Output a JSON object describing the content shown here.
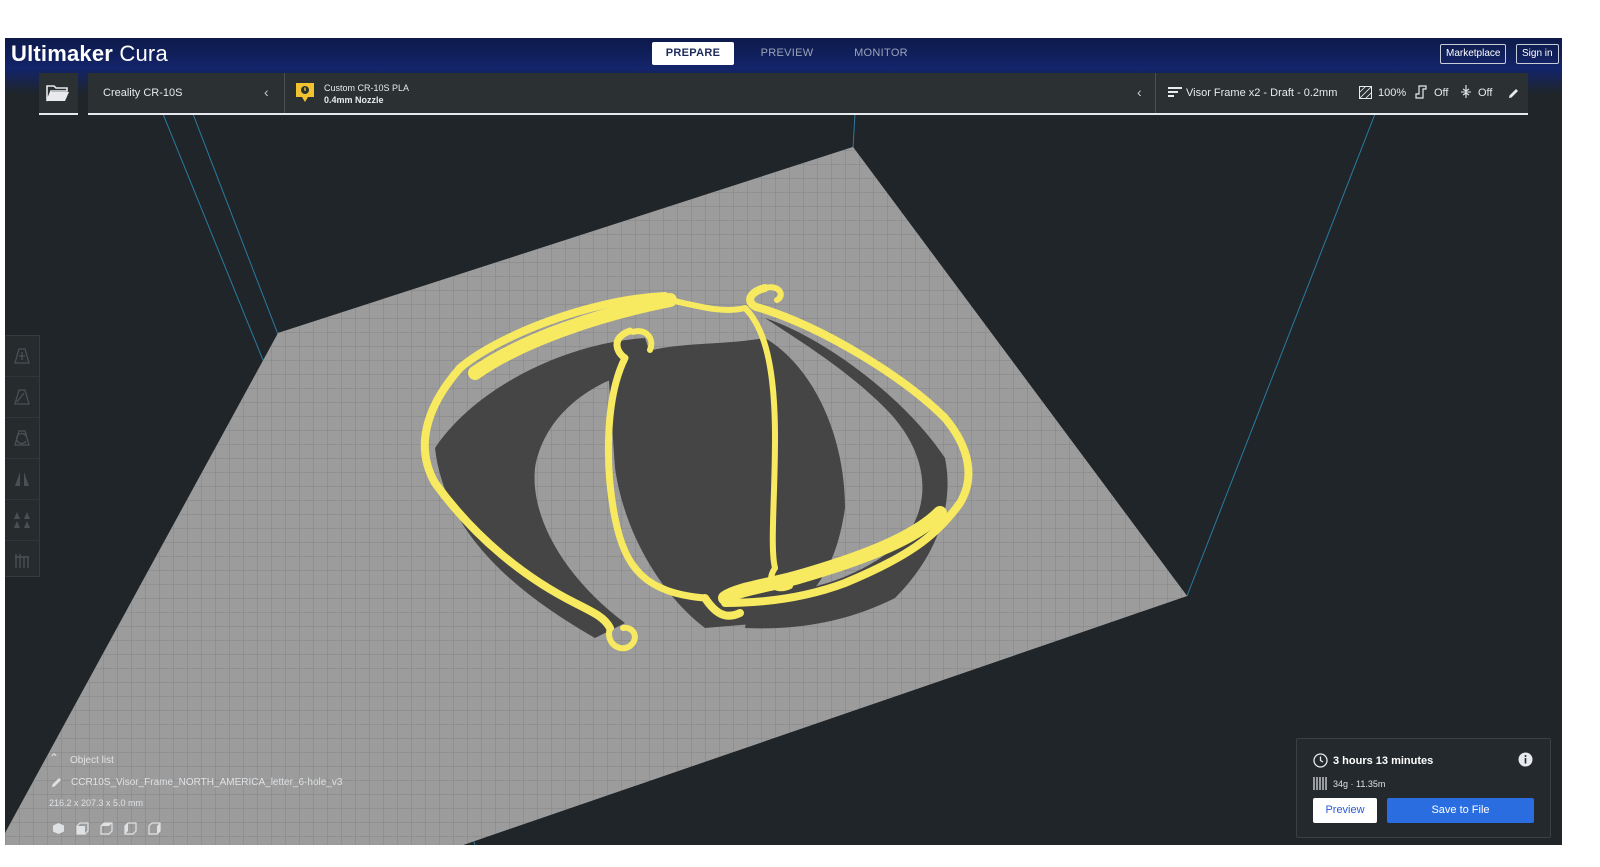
{
  "app": {
    "brand_bold": "Ultimaker",
    "brand_light": "Cura"
  },
  "stages": [
    {
      "label": "PREPARE",
      "active": true
    },
    {
      "label": "PREVIEW",
      "active": false
    },
    {
      "label": "MONITOR",
      "active": false
    }
  ],
  "header": {
    "marketplace": "Marketplace",
    "sign_in": "Sign in"
  },
  "toolbar": {
    "printer": "Creality CR-10S",
    "material": "Custom CR-10S PLA",
    "nozzle": "0.4mm Nozzle",
    "profile": "Visor Frame x2 - Draft - 0.2mm",
    "infill": "100%",
    "support": "Off",
    "adhesion": "Off"
  },
  "object_list": {
    "title": "Object list",
    "object_name": "CCR10S_Visor_Frame_NORTH_AMERICA_letter_6-hole_v3",
    "dimensions": "216.2 x 207.3 x 5.0 mm"
  },
  "print_info": {
    "time": "3 hours 13 minutes",
    "material_usage": "34g · 11.35m",
    "preview_label": "Preview",
    "save_label": "Save to File"
  },
  "colors": {
    "accent": "#2a6de0",
    "model": "#f7ea60",
    "header": "#13246a",
    "background": "#1f2528",
    "build_plate": "#9c9c9c"
  }
}
